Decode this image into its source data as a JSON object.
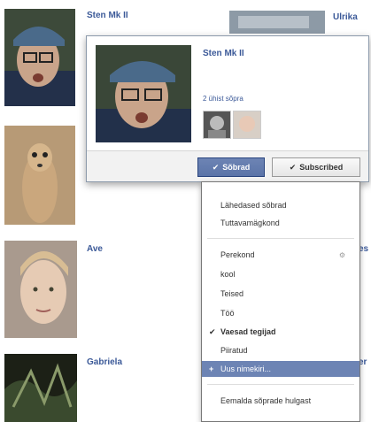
{
  "friends": [
    {
      "name": "Sten Mk II"
    },
    {
      "name": ""
    },
    {
      "name": "Ave"
    },
    {
      "name": "Gabriela"
    }
  ],
  "partial_right": {
    "top_name": "Ulrika",
    "mid_fragment": "es",
    "low_fragment": "er"
  },
  "hovercard": {
    "name": "Sten Mk II",
    "mutual": "2 ühist sõpra",
    "friends_button": "Sõbrad",
    "subscribed_button": "Subscribed"
  },
  "dropdown": {
    "items": [
      "Lähedased sõbrad",
      "Tuttavamägkond",
      "Perekond",
      "kool",
      "Teised",
      "Töö",
      "Vaesad tegijad",
      "Piiratud",
      "Uus nimekiri...",
      "Eemalda sõprade hulgast"
    ],
    "checked_item": "Vaesad tegijad",
    "highlighted_item": "Uus nimekiri..."
  },
  "colors": {
    "link": "#3b5998",
    "button_blue": "#6d84b4",
    "highlight": "#6d84b4"
  }
}
